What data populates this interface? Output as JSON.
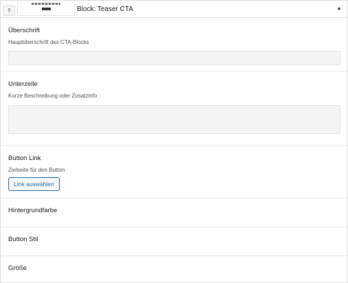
{
  "header": {
    "index": "0",
    "title": "Block: Teaser CTA",
    "toggle_glyph": "▲"
  },
  "fields": {
    "ueberschrift": {
      "label": "Überschrift",
      "description": "Hauptüberschrift des CTA-Blocks",
      "value": ""
    },
    "unterzeile": {
      "label": "Unterzeile",
      "description": "Kurze Beschreibung oder Zusatzinfo",
      "value": ""
    },
    "button_link": {
      "label": "Button Link",
      "description": "Zielseite für den Button",
      "button_label": "Link auswählen"
    },
    "hintergrundfarbe": {
      "label": "Hintergrundfarbe"
    },
    "button_stil": {
      "label": "Button Stil"
    },
    "groesse": {
      "label": "Größe"
    }
  },
  "colors": {
    "accent": "#2271b1",
    "input_bg": "#f4f4f4",
    "divider": "#e6e6e6"
  }
}
